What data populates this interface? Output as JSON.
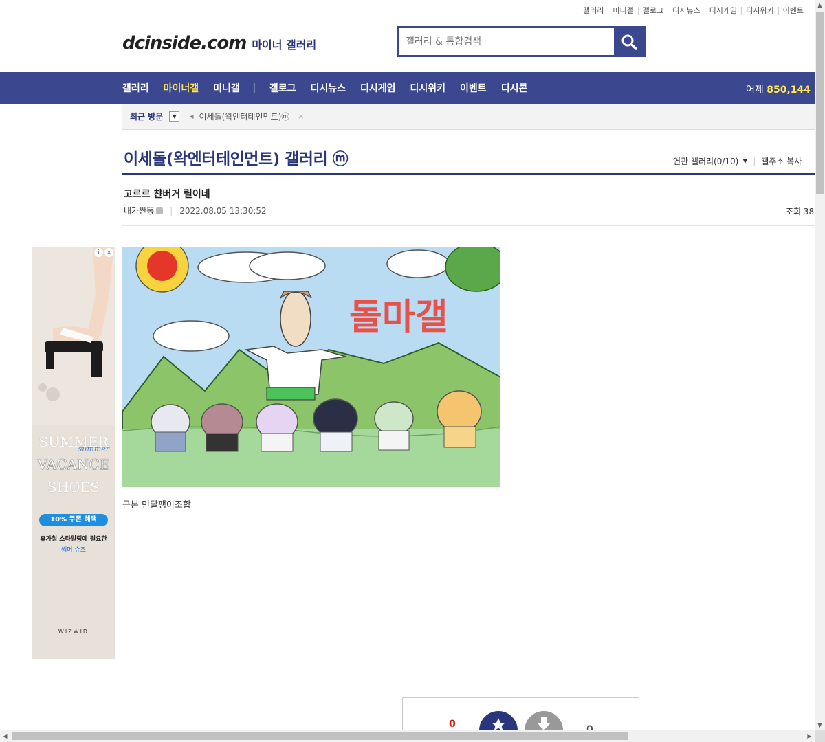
{
  "top_links": [
    "갤러리",
    "미니갤",
    "갤로그",
    "디시뉴스",
    "디시게임",
    "디시위키",
    "이벤트"
  ],
  "logo": {
    "brand": "dcinside.com",
    "sub": "마이너 갤러리"
  },
  "search": {
    "placeholder": "갤러리 & 통합검색",
    "icon": "search-icon"
  },
  "nav": {
    "items": [
      "갤러리",
      "마이너갤",
      "미니갤",
      "갤로그",
      "디시뉴스",
      "디시게임",
      "디시위키",
      "이벤트",
      "디시콘"
    ],
    "active": "마이너갤",
    "stat_label": "어제",
    "stat_value": "850,144"
  },
  "recent": {
    "label": "최근 방문",
    "item": "이세돌(왁엔터테인먼트)ⓜ",
    "close": "×"
  },
  "gallery": {
    "title": "이세돌(왁엔터테인먼트) 갤러리 ⓜ",
    "related": "연관 갤러리(0/10)",
    "copy": "갤주소 복사"
  },
  "post": {
    "title": "고르르 챤버거 릴이네",
    "author": "내가싼똥",
    "date": "2022.08.05 13:30:52",
    "views_label": "조회 38",
    "caption": "근본 민달팽이조합",
    "image_text": "돌마갤"
  },
  "ad": {
    "line1": "SUMMER",
    "script": "summer",
    "line2": "VACANCE",
    "line3": "SHOES",
    "coupon": "10% 쿠폰 혜택",
    "desc": "휴가철 스타일링에 필요한",
    "desc2": "썸머 슈즈",
    "brand": "WIZWID"
  },
  "vote": {
    "up_count": "0",
    "down_count": "0"
  },
  "colors": {
    "brand_blue": "#3b4890",
    "nav_active": "#ffe74b",
    "vote_up": "#d31900"
  }
}
